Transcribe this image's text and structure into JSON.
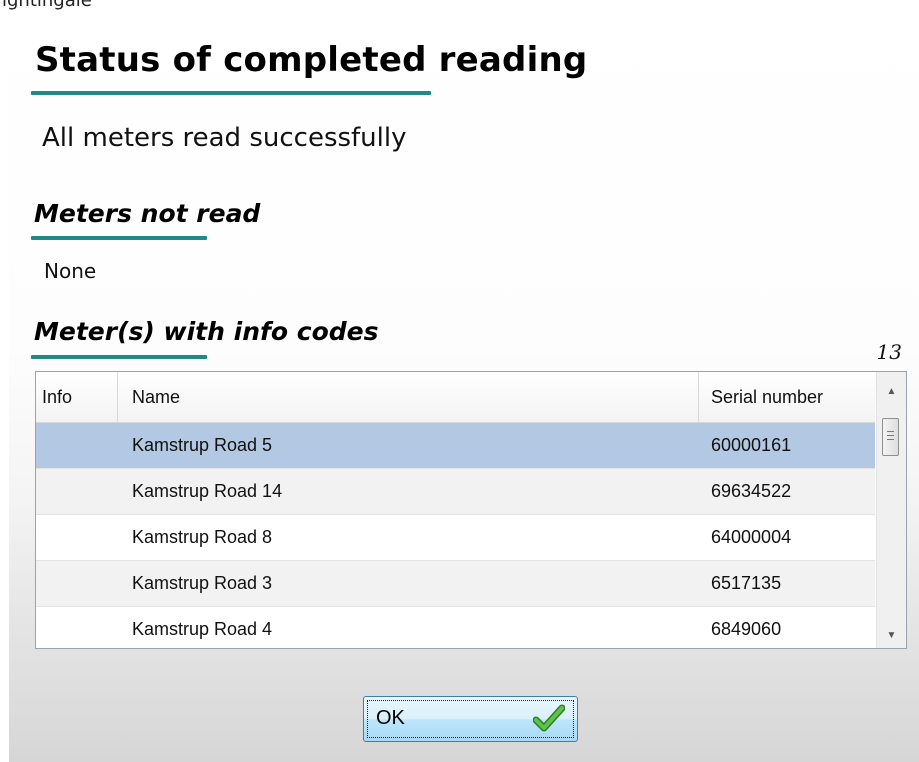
{
  "background_text": "ightingale",
  "dialog": {
    "title": "Status of completed reading",
    "status_message": "All meters read successfully",
    "meters_not_read": {
      "heading": "Meters not read",
      "value": "None"
    },
    "meters_with_info_codes": {
      "heading": "Meter(s) with info codes",
      "count": "13",
      "columns": [
        "Info",
        "Name",
        "Serial number"
      ],
      "rows": [
        {
          "info": "",
          "name": "Kamstrup Road 5",
          "serial": "60000161",
          "selected": true
        },
        {
          "info": "",
          "name": "Kamstrup Road 14",
          "serial": "69634522",
          "selected": false
        },
        {
          "info": "",
          "name": "Kamstrup Road 8",
          "serial": "64000004",
          "selected": false
        },
        {
          "info": "",
          "name": "Kamstrup Road 3",
          "serial": "6517135",
          "selected": false
        },
        {
          "info": "",
          "name": "Kamstrup Road 4",
          "serial": "6849060",
          "selected": false
        }
      ]
    },
    "ok_button": {
      "label": "OK",
      "icon": "checkmark-icon"
    }
  },
  "colors": {
    "underline_accent": "#1f8a8a",
    "selected_row": "#b3c8e2",
    "check_green": "#3aa52e"
  }
}
